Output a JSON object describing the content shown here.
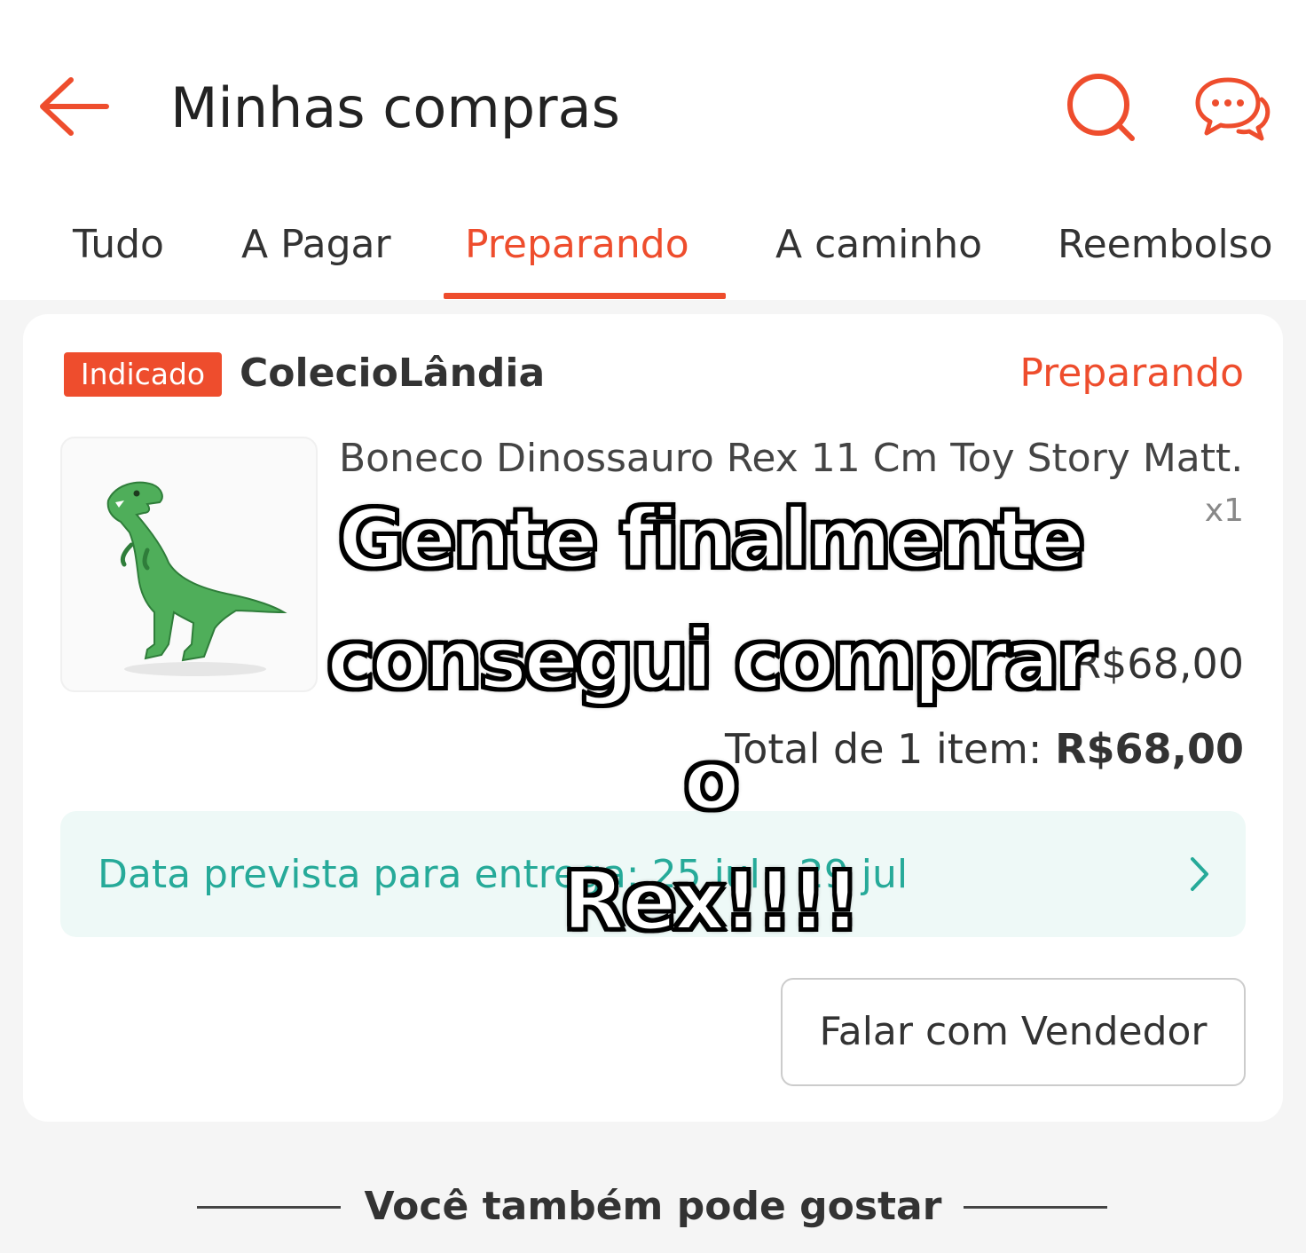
{
  "header": {
    "title": "Minhas compras"
  },
  "tabs": [
    "Tudo",
    "A Pagar",
    "Preparando",
    "A caminho",
    "Reembolso"
  ],
  "order": {
    "badge": "Indicado",
    "shop": "ColecioLândia",
    "status": "Preparando",
    "product_name": "Boneco Dinossauro Rex 11 Cm Toy Story Matt...",
    "quantity": "x1",
    "price": "R$68,00",
    "total_label": "Total de 1 item: ",
    "total_value": "R$68,00",
    "delivery": "Data prevista para entrega: 25 jul - 29 jul",
    "chat_button": "Falar com Vendedor"
  },
  "also_like": "Você também pode gostar",
  "caption": {
    "line1": "Gente finalmente",
    "line2": "consegui comprar o",
    "line3": "Rex!!!!"
  },
  "colors": {
    "accent": "#ee4d2d",
    "delivery": "#26aa99",
    "delivery_bg": "#eef9f7"
  },
  "icons": {
    "back": "arrow-left-icon",
    "search": "search-icon",
    "chat": "chat-bubbles-icon",
    "chevron": "chevron-right-icon"
  }
}
